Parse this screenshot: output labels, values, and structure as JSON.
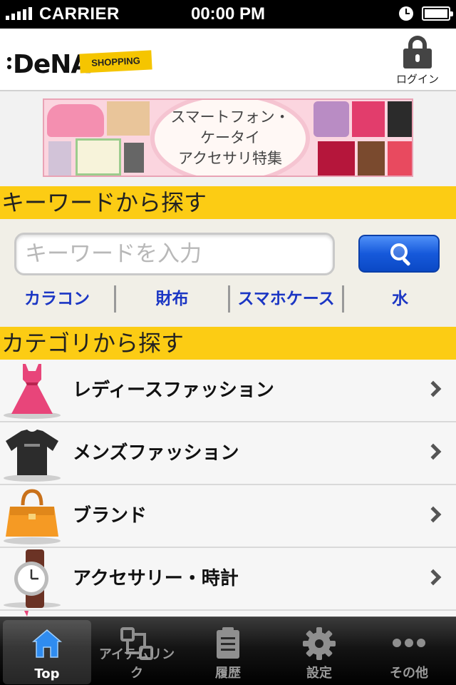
{
  "status_bar": {
    "carrier": "CARRIER",
    "time": "00:00 PM"
  },
  "header": {
    "logo": "DeNA",
    "logo_badge": "SHOPPING",
    "login_label": "ログイン"
  },
  "banner": {
    "lines": [
      "スマートフォン・",
      "ケータイ",
      "アクセサリ特集"
    ]
  },
  "keyword_section": {
    "title": "キーワードから探す",
    "search_placeholder": "キーワードを入力",
    "keywords": [
      "カラコン",
      "財布",
      "スマホケース",
      "水"
    ]
  },
  "category_section": {
    "title": "カテゴリから探す",
    "items": [
      {
        "label": "レディースファッション",
        "icon": "dress-icon"
      },
      {
        "label": "メンズファッション",
        "icon": "tshirt-icon"
      },
      {
        "label": "ブランド",
        "icon": "handbag-icon"
      },
      {
        "label": "アクセサリー・時計",
        "icon": "watch-icon"
      }
    ]
  },
  "tab_bar": {
    "tabs": [
      {
        "label": "Top",
        "icon": "home-icon",
        "active": true
      },
      {
        "label": "アイテムリンク",
        "icon": "item-link-icon",
        "active": false
      },
      {
        "label": "履歴",
        "icon": "history-icon",
        "active": false
      },
      {
        "label": "設定",
        "icon": "gear-icon",
        "active": false
      },
      {
        "label": "その他",
        "icon": "more-icon",
        "active": false
      }
    ]
  },
  "colors": {
    "section_header": "#fccc14",
    "keyword_link": "#1b36c4",
    "search_button": "#1659db",
    "tab_active_icon": "#2f8cf0"
  }
}
